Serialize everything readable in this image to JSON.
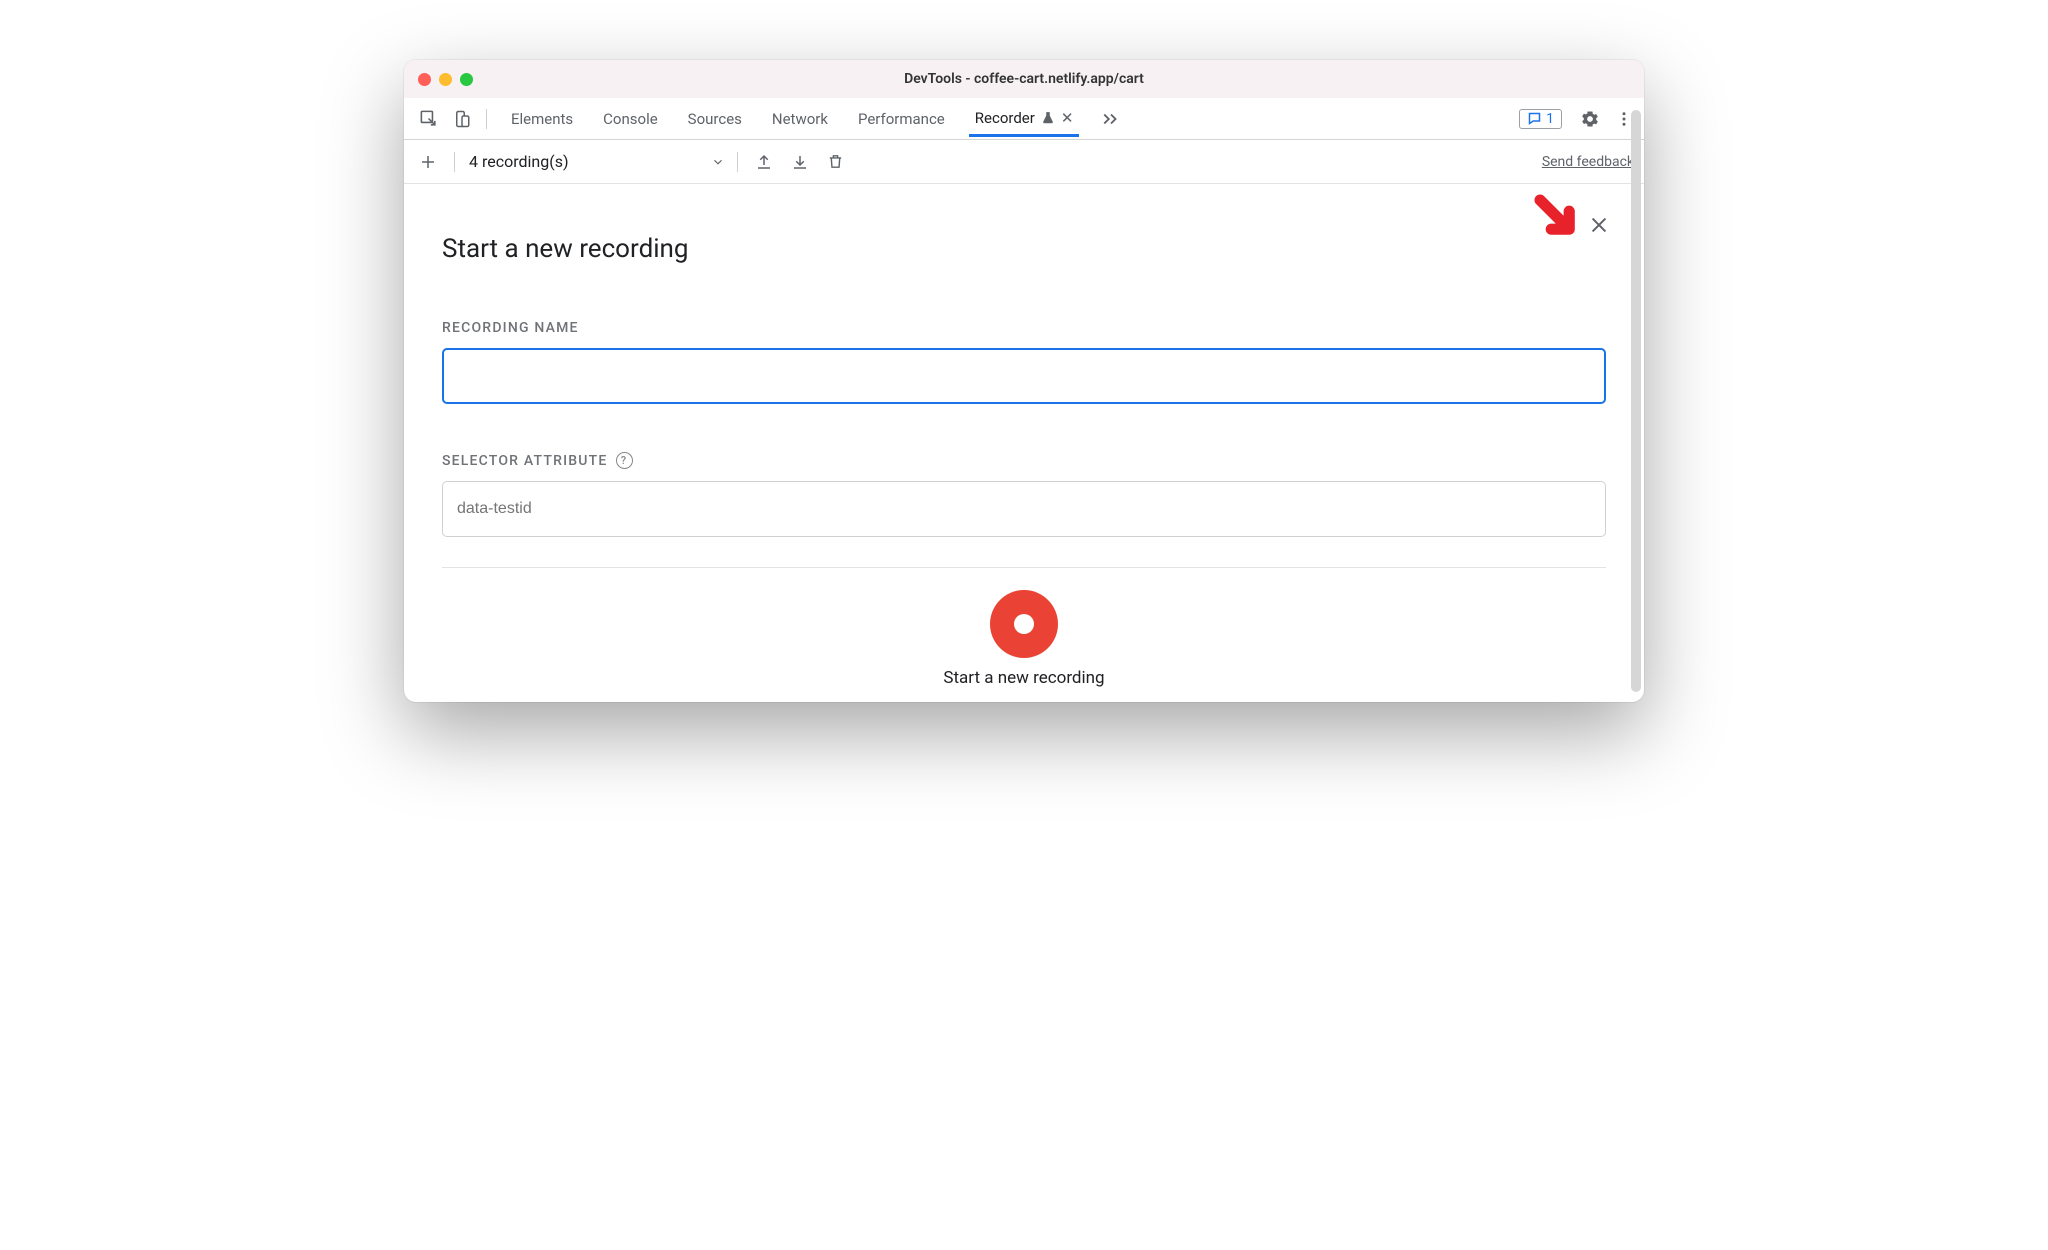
{
  "window": {
    "title": "DevTools - coffee-cart.netlify.app/cart"
  },
  "tabs": {
    "items": [
      "Elements",
      "Console",
      "Sources",
      "Network",
      "Performance"
    ],
    "active": {
      "label": "Recorder"
    }
  },
  "chat_badge": {
    "count": "1"
  },
  "toolbar": {
    "recordings_label": "4 recording(s)",
    "feedback": "Send feedback"
  },
  "panel": {
    "title": "Start a new recording",
    "recording_name_label": "RECORDING NAME",
    "recording_name_value": "",
    "selector_label": "SELECTOR ATTRIBUTE",
    "selector_placeholder": "data-testid",
    "start_button_label": "Start a new recording"
  },
  "colors": {
    "accent_blue": "#1a73e8",
    "record_red": "#ea4335"
  }
}
